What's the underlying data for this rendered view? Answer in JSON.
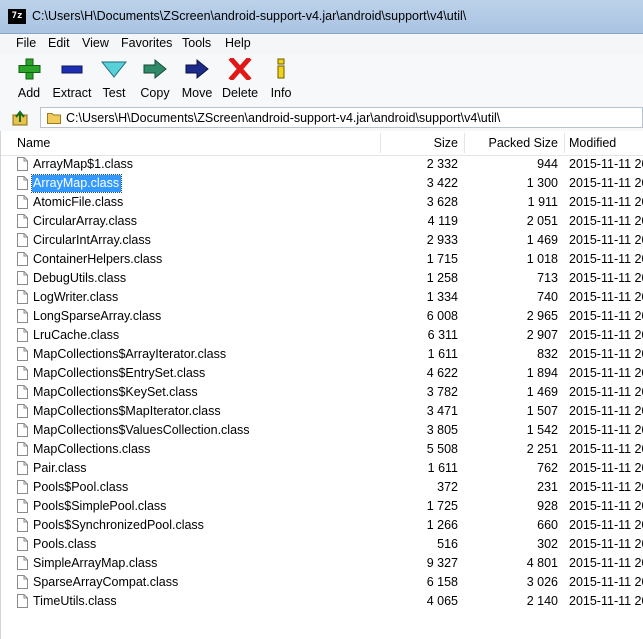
{
  "window": {
    "title": "C:\\Users\\H\\Documents\\ZScreen\\android-support-v4.jar\\android\\support\\v4\\util\\",
    "app_icon_text": "7z"
  },
  "menu": [
    "File",
    "Edit",
    "View",
    "Favorites",
    "Tools",
    "Help"
  ],
  "toolbar": [
    {
      "label": "Add",
      "icon": "plus-icon"
    },
    {
      "label": "Extract",
      "icon": "minus-icon"
    },
    {
      "label": "Test",
      "icon": "check-icon"
    },
    {
      "label": "Copy",
      "icon": "copy-arrow-icon"
    },
    {
      "label": "Move",
      "icon": "move-arrow-icon"
    },
    {
      "label": "Delete",
      "icon": "x-icon"
    },
    {
      "label": "Info",
      "icon": "info-icon"
    }
  ],
  "address": {
    "path": "C:\\Users\\H\\Documents\\ZScreen\\android-support-v4.jar\\android\\support\\v4\\util\\"
  },
  "columns": {
    "name": "Name",
    "size": "Size",
    "packed": "Packed Size",
    "modified": "Modified"
  },
  "files": [
    {
      "name": "ArrayMap$1.class",
      "size": "2 332",
      "packed": "944",
      "modified": "2015-11-11 20"
    },
    {
      "name": "ArrayMap.class",
      "size": "3 422",
      "packed": "1 300",
      "modified": "2015-11-11 20",
      "selected": true
    },
    {
      "name": "AtomicFile.class",
      "size": "3 628",
      "packed": "1 911",
      "modified": "2015-11-11 20"
    },
    {
      "name": "CircularArray.class",
      "size": "4 119",
      "packed": "2 051",
      "modified": "2015-11-11 20"
    },
    {
      "name": "CircularIntArray.class",
      "size": "2 933",
      "packed": "1 469",
      "modified": "2015-11-11 20"
    },
    {
      "name": "ContainerHelpers.class",
      "size": "1 715",
      "packed": "1 018",
      "modified": "2015-11-11 20"
    },
    {
      "name": "DebugUtils.class",
      "size": "1 258",
      "packed": "713",
      "modified": "2015-11-11 20"
    },
    {
      "name": "LogWriter.class",
      "size": "1 334",
      "packed": "740",
      "modified": "2015-11-11 20"
    },
    {
      "name": "LongSparseArray.class",
      "size": "6 008",
      "packed": "2 965",
      "modified": "2015-11-11 20"
    },
    {
      "name": "LruCache.class",
      "size": "6 311",
      "packed": "2 907",
      "modified": "2015-11-11 20"
    },
    {
      "name": "MapCollections$ArrayIterator.class",
      "size": "1 611",
      "packed": "832",
      "modified": "2015-11-11 20"
    },
    {
      "name": "MapCollections$EntrySet.class",
      "size": "4 622",
      "packed": "1 894",
      "modified": "2015-11-11 20"
    },
    {
      "name": "MapCollections$KeySet.class",
      "size": "3 782",
      "packed": "1 469",
      "modified": "2015-11-11 20"
    },
    {
      "name": "MapCollections$MapIterator.class",
      "size": "3 471",
      "packed": "1 507",
      "modified": "2015-11-11 20"
    },
    {
      "name": "MapCollections$ValuesCollection.class",
      "size": "3 805",
      "packed": "1 542",
      "modified": "2015-11-11 20"
    },
    {
      "name": "MapCollections.class",
      "size": "5 508",
      "packed": "2 251",
      "modified": "2015-11-11 20"
    },
    {
      "name": "Pair.class",
      "size": "1 611",
      "packed": "762",
      "modified": "2015-11-11 20"
    },
    {
      "name": "Pools$Pool.class",
      "size": "372",
      "packed": "231",
      "modified": "2015-11-11 20"
    },
    {
      "name": "Pools$SimplePool.class",
      "size": "1 725",
      "packed": "928",
      "modified": "2015-11-11 20"
    },
    {
      "name": "Pools$SynchronizedPool.class",
      "size": "1 266",
      "packed": "660",
      "modified": "2015-11-11 20"
    },
    {
      "name": "Pools.class",
      "size": "516",
      "packed": "302",
      "modified": "2015-11-11 20"
    },
    {
      "name": "SimpleArrayMap.class",
      "size": "9 327",
      "packed": "4 801",
      "modified": "2015-11-11 20"
    },
    {
      "name": "SparseArrayCompat.class",
      "size": "6 158",
      "packed": "3 026",
      "modified": "2015-11-11 20"
    },
    {
      "name": "TimeUtils.class",
      "size": "4 065",
      "packed": "2 140",
      "modified": "2015-11-11 20"
    }
  ]
}
